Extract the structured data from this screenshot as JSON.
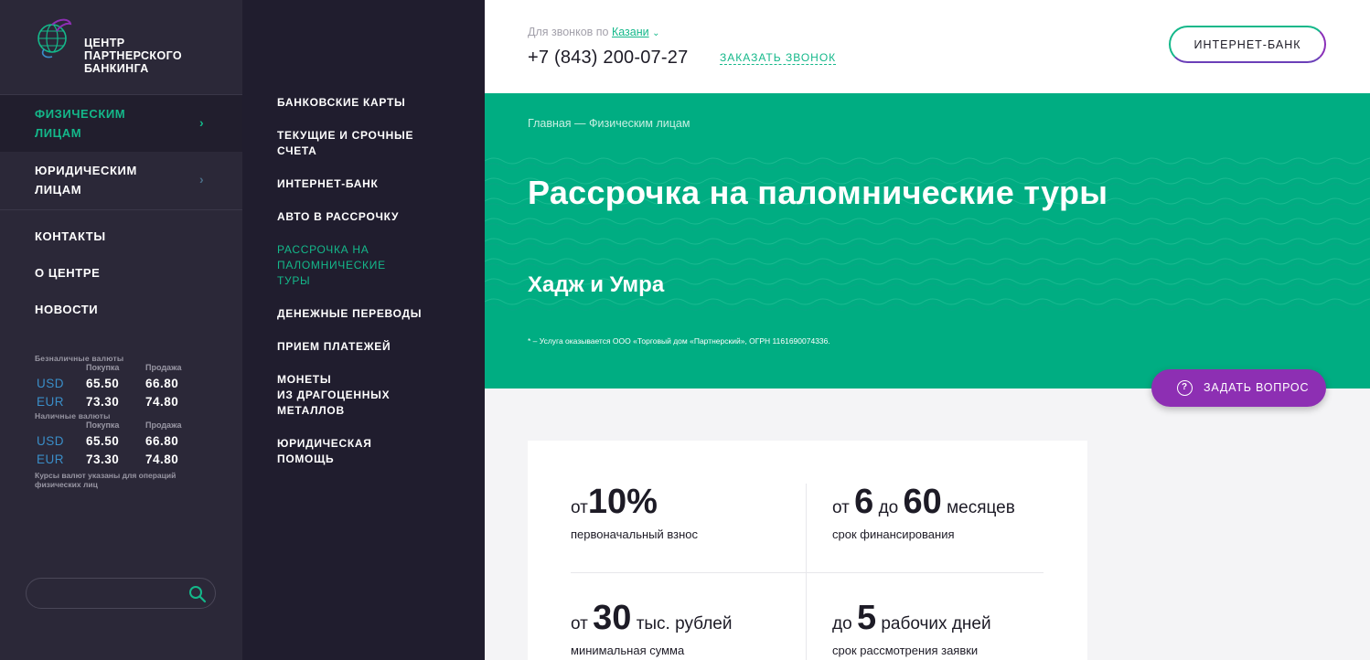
{
  "brand": {
    "line1": "ЦЕНТР",
    "line2": "ПАРТНЕРСКОГО",
    "line3": "БАНКИНГА",
    "logo_icon": "globe-leaf-logo-icon"
  },
  "nav": {
    "individuals_l1": "ФИЗИЧЕСКИМ",
    "individuals_l2": "ЛИЦАМ",
    "legal_l1": "ЮРИДИЧЕСКИМ",
    "legal_l2": "ЛИЦАМ",
    "chevron": "›",
    "contacts": "КОНТАКТЫ",
    "about": "О ЦЕНТРЕ",
    "news": "НОВОСТИ"
  },
  "rates": {
    "cashless_caption": "Безналичные валюты",
    "cash_caption": "Наличные валюты",
    "buy_label": "Покупка",
    "sell_label": "Продажа",
    "cashless": [
      {
        "currency": "USD",
        "buy": "65.50",
        "sell": "66.80"
      },
      {
        "currency": "EUR",
        "buy": "73.30",
        "sell": "74.80"
      }
    ],
    "cash": [
      {
        "currency": "USD",
        "buy": "65.50",
        "sell": "66.80"
      },
      {
        "currency": "EUR",
        "buy": "73.30",
        "sell": "74.80"
      }
    ],
    "note_l1": "Курсы валют указаны для операций",
    "note_l2": "физических лиц"
  },
  "search": {
    "placeholder": "",
    "icon": "search-icon"
  },
  "submenu": [
    {
      "lines": [
        "БАНКОВСКИЕ КАРТЫ"
      ],
      "active": false
    },
    {
      "lines": [
        "ТЕКУЩИЕ И СРОЧНЫЕ",
        "СЧЕТА"
      ],
      "active": false
    },
    {
      "lines": [
        "ИНТЕРНЕТ-БАНК"
      ],
      "active": false
    },
    {
      "lines": [
        "АВТО В РАССРОЧКУ"
      ],
      "active": false
    },
    {
      "lines": [
        "РАССРОЧКА НА",
        "ПАЛОМНИЧЕСКИЕ",
        "ТУРЫ"
      ],
      "active": true
    },
    {
      "lines": [
        "ДЕНЕЖНЫЕ ПЕРЕВОДЫ"
      ],
      "active": false
    },
    {
      "lines": [
        "ПРИЕМ ПЛАТЕЖЕЙ"
      ],
      "active": false
    },
    {
      "lines": [
        "МОНЕТЫ",
        "ИЗ ДРАГОЦЕННЫХ",
        "МЕТАЛЛОВ"
      ],
      "active": false
    },
    {
      "lines": [
        "ЮРИДИЧЕСКАЯ",
        "ПОМОЩЬ"
      ],
      "active": false
    }
  ],
  "header": {
    "call_caption": "Для звонков по",
    "city": "Казани",
    "city_dropdown": "⌄",
    "phone": "+7 (843) 200-07-27",
    "callback": "ЗАКАЗАТЬ ЗВОНОК",
    "internet_bank": "ИНТЕРНЕТ-БАНК"
  },
  "hero": {
    "breadcrumb": "Главная — Физическим лицам",
    "title": "Рассрочка на паломнические туры",
    "subtitle": "Хадж и Умра",
    "note": "* – Услуга оказывается ООО «Торговый дом «Партнерский», ОГРН 1161690074336."
  },
  "ask": {
    "icon": "question-icon",
    "icon_glyph": "?",
    "label": "ЗАДАТЬ ВОПРОС"
  },
  "terms": {
    "t1": {
      "pre": "от",
      "num": "10%",
      "post": "",
      "desc": "первоначальный взнос"
    },
    "t2": {
      "pre": "от",
      "num": "6",
      "mid": "до",
      "num2": "60",
      "post": "месяцев",
      "desc": "срок финансирования"
    },
    "t3": {
      "pre": "от",
      "num": "30",
      "post": "тыс. рублей",
      "desc": "минимальная сумма"
    },
    "t4": {
      "pre": "до",
      "num": "5",
      "post": "рабочих дней",
      "desc": "срок рассмотрения заявки"
    }
  },
  "colors": {
    "accent": "#00ad82",
    "purple": "#8d2fb3",
    "sidebar": "#2b2838",
    "submenu": "#201d2e"
  }
}
